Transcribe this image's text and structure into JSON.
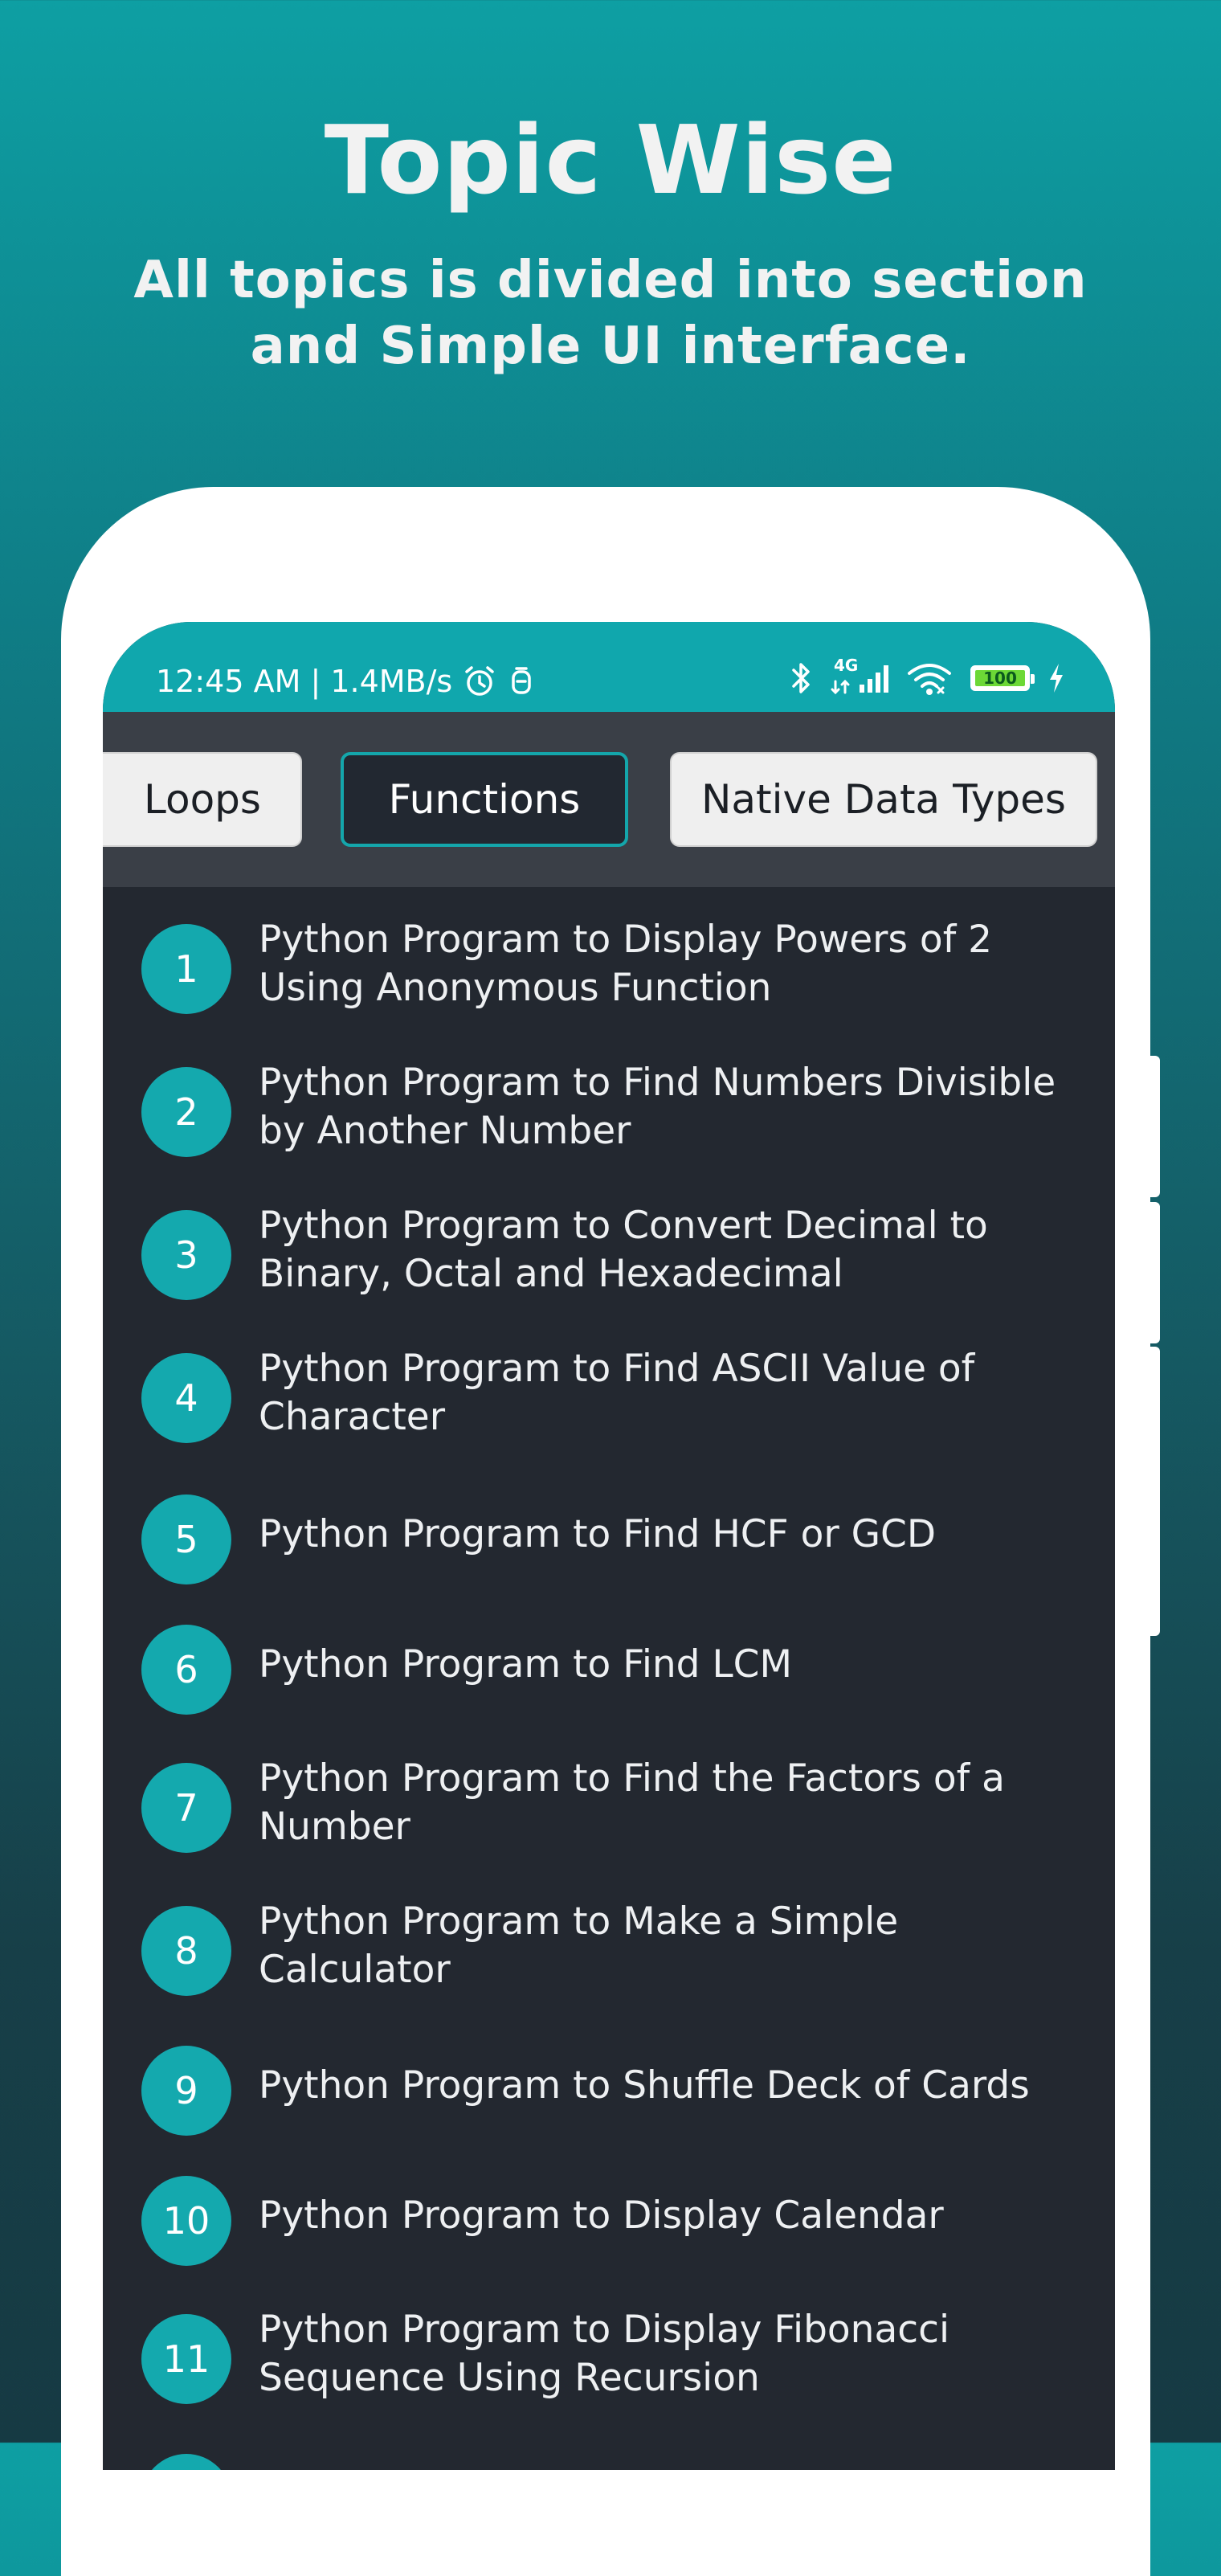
{
  "promo": {
    "title": "Topic Wise",
    "subtitle": "All topics is divided into section and Simple UI interface."
  },
  "status_bar": {
    "time": "12:45 AM | 1.4MB/s",
    "network": "4G",
    "battery": "100",
    "accent": "#10a7ad"
  },
  "tabs": [
    {
      "label": "Loops",
      "selected": false
    },
    {
      "label": "Functions",
      "selected": true
    },
    {
      "label": "Native Data Types",
      "selected": false
    }
  ],
  "list": {
    "items": [
      {
        "num": "1",
        "text": "Python Program to Display Powers of 2 Using Anonymous Function"
      },
      {
        "num": "2",
        "text": "Python Program to Find Numbers Divisible by Another Number"
      },
      {
        "num": "3",
        "text": "Python Program to Convert Decimal to Binary, Octal and Hexadecimal"
      },
      {
        "num": "4",
        "text": "Python Program to Find ASCII Value of Character"
      },
      {
        "num": "5",
        "text": "Python Program to Find HCF or GCD"
      },
      {
        "num": "6",
        "text": "Python Program to Find LCM"
      },
      {
        "num": "7",
        "text": "Python Program to Find the Factors of a Number"
      },
      {
        "num": "8",
        "text": "Python Program to Make a Simple Calculator"
      },
      {
        "num": "9",
        "text": "Python Program to Shuffle Deck of Cards"
      },
      {
        "num": "10",
        "text": "Python Program to Display Calendar"
      },
      {
        "num": "11",
        "text": "Python Program to Display Fibonacci Sequence Using Recursion"
      }
    ]
  },
  "icons": {
    "status": [
      "alarm-icon",
      "notification-icon",
      "bluetooth-icon",
      "signal-icon",
      "wifi-icon",
      "battery-icon",
      "charging-icon"
    ]
  }
}
